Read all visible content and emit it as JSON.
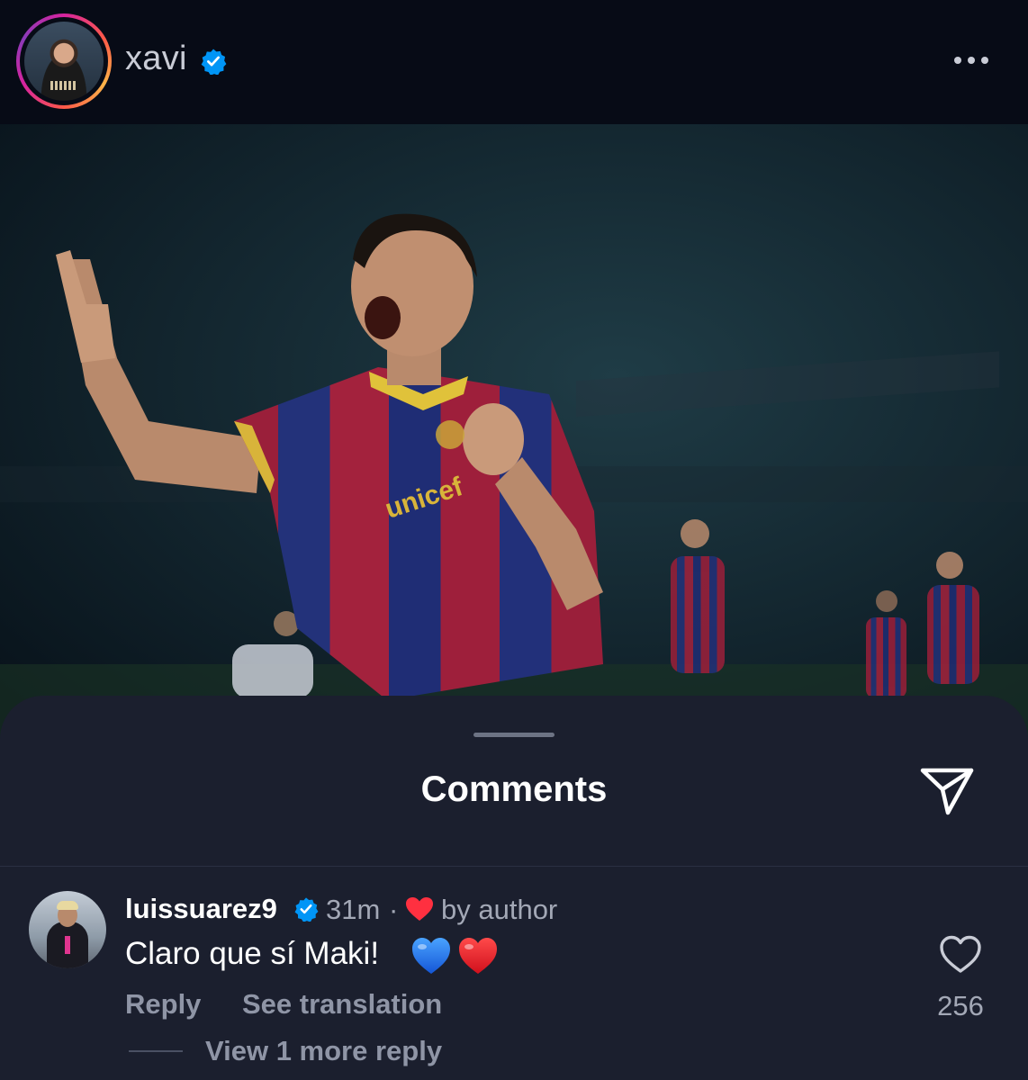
{
  "header": {
    "username": "xavi",
    "verified": true,
    "more_icon": "more-horizontal-icon"
  },
  "post": {
    "image_alt": "Celebration photo"
  },
  "comments_sheet": {
    "title": "Comments",
    "share_icon": "send-icon",
    "comment": {
      "username": "luissuarez9",
      "verified": true,
      "time": "31m",
      "separator": "·",
      "liked_by_author_label": "by author",
      "text": "Claro que sí Maki!",
      "emojis": [
        "blue-heart",
        "red-heart"
      ],
      "reply_label": "Reply",
      "translate_label": "See translation",
      "like_count": "256",
      "view_replies_label": "View 1 more reply"
    }
  },
  "colors": {
    "background": "#0b0f1a",
    "sheet": "#1b1f2e",
    "verified_blue": "#0095f6",
    "heart_red": "#ff3040",
    "secondary_text": "#a3a8b6"
  }
}
